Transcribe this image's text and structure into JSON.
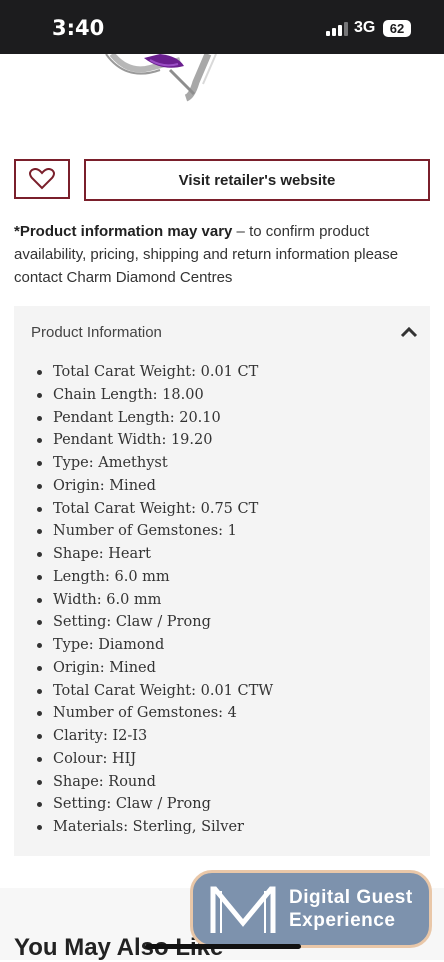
{
  "status_bar": {
    "time": "3:40",
    "network": "3G",
    "battery": "62"
  },
  "actions": {
    "visit_label": "Visit retailer's website"
  },
  "notice": {
    "bold": "*Product information may vary",
    "text": " – to confirm product availability, pricing, shipping and return information please contact Charm Diamond Centres"
  },
  "product_info": {
    "title": "Product Information",
    "specs": [
      "Total Carat Weight: 0.01 CT",
      "Chain Length: 18.00",
      "Pendant Length: 20.10",
      "Pendant Width: 19.20",
      "Type: Amethyst",
      "Origin: Mined",
      "Total Carat Weight: 0.75 CT",
      "Number of Gemstones: 1",
      "Shape: Heart",
      "Length: 6.0 mm",
      "Width: 6.0 mm",
      "Setting: Claw / Prong",
      "Type: Diamond",
      "Origin: Mined",
      "Total Carat Weight: 0.01 CTW",
      "Number of Gemstones: 4",
      "Clarity: I2-I3",
      "Colour: HIJ",
      "Shape: Round",
      "Setting: Claw / Prong",
      "Materials: Sterling, Silver"
    ]
  },
  "section": {
    "heading": "You May Also Like"
  },
  "guest_widget": {
    "line1": "Digital Guest",
    "line2": "Experience"
  },
  "colors": {
    "accent": "#7a1f2b",
    "widget": "#7d92ad",
    "widget_border": "#e9c7a8"
  }
}
